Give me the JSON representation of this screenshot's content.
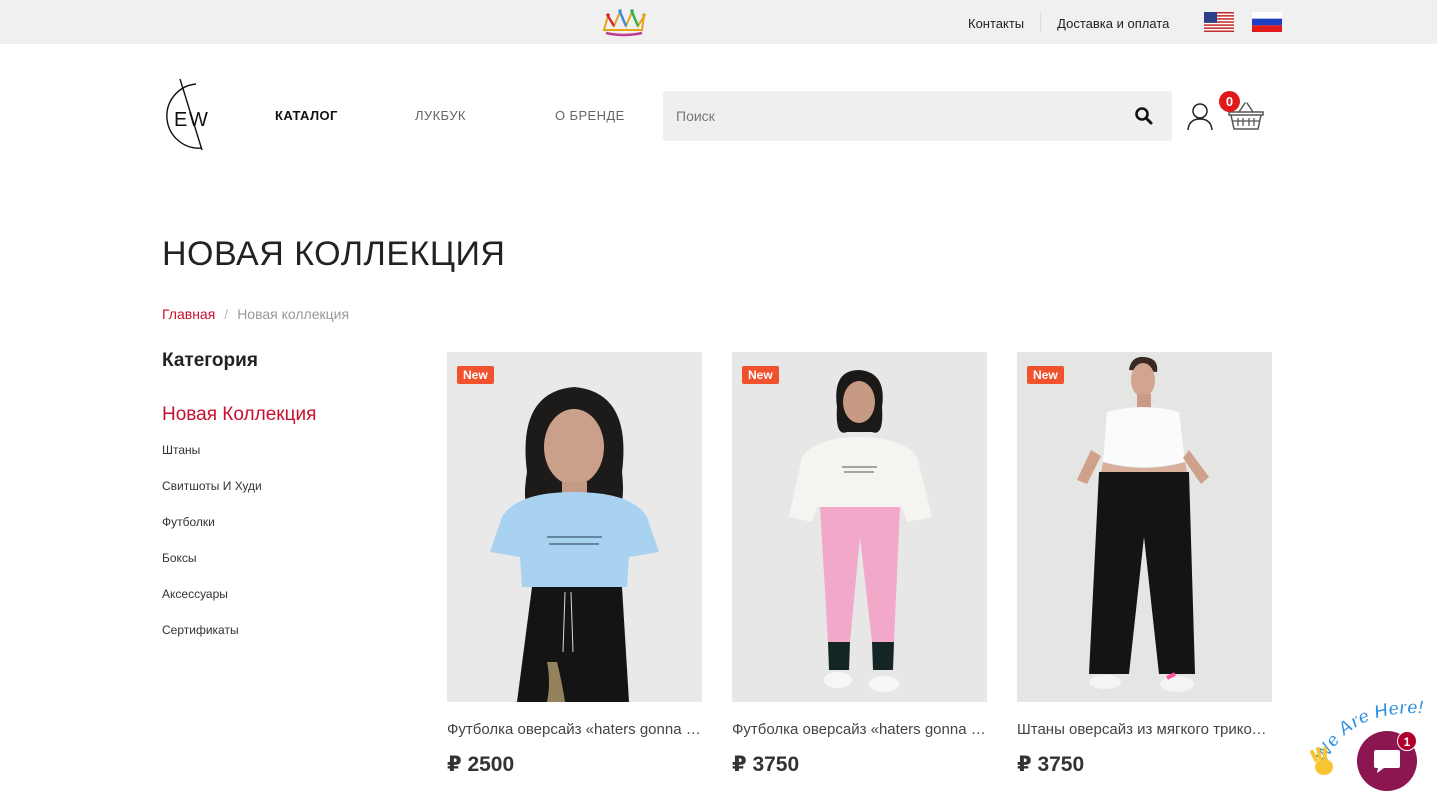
{
  "topbar": {
    "links": [
      {
        "label": "Контакты"
      },
      {
        "label": "Доставка и оплата"
      }
    ],
    "flags": [
      "us-flag-icon",
      "ru-flag-icon"
    ],
    "logo_icon": "crown-logo-icon"
  },
  "header": {
    "logo_icon": "ew-logo-icon",
    "nav": {
      "catalog": "КАТАЛОГ",
      "lookbook": "ЛУКБУК",
      "brand": "О БРЕНДЕ"
    },
    "search": {
      "placeholder": "Поиск",
      "icon": "search-icon"
    },
    "user_icon": "user-icon",
    "cart": {
      "icon": "basket-icon",
      "count": "0"
    }
  },
  "page": {
    "title": "НОВАЯ КОЛЛЕКЦИЯ",
    "breadcrumb": {
      "home": "Главная",
      "separator": "/",
      "current": "Новая коллекция"
    }
  },
  "sidebar": {
    "title": "Категория",
    "active": "Новая Коллекция",
    "items": [
      "Штаны",
      "Свитшоты И Худи",
      "Футболки",
      "Боксы",
      "Аксессуары",
      "Сертификаты"
    ]
  },
  "products": [
    {
      "badge": "New",
      "name": "Футболка оверсайз «haters gonna hate»",
      "price": "₽ 2500"
    },
    {
      "badge": "New",
      "name": "Футболка оверсайз «haters gonna hate»",
      "price": "₽ 3750"
    },
    {
      "badge": "New",
      "name": "Штаны оверсайз из мягкого трикотажа",
      "price": "₽ 3750"
    }
  ],
  "chat": {
    "banner": "We Are Here!",
    "unread": "1"
  },
  "colors": {
    "accent_red": "#c8102e",
    "badge_orange": "#f0522d",
    "chat_purple": "#8b1650",
    "topbar_bg": "#f0f0f0"
  }
}
